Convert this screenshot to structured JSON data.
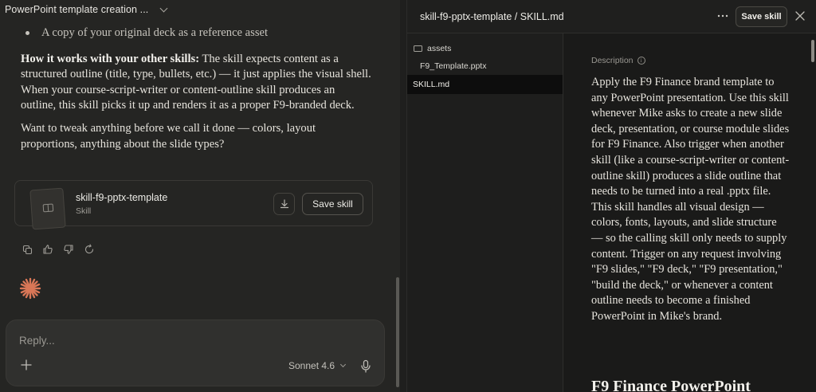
{
  "conversation": {
    "title": "PowerPoint template creation ...",
    "bullet_text": "A copy of your original deck as a reference asset",
    "para1_bold": "How it works with your other skills:",
    "para1_rest": " The skill expects content as a structured outline (title, type, bullets, etc.) — it just applies the visual shell. When your course-script-writer or content-outline skill produces an outline, this skill picks it up and renders it as a proper F9-branded deck.",
    "para2": "Want to tweak anything before we call it done — colors, layout proportions, anything about the slide types?",
    "skill_card": {
      "name": "skill-f9-pptx-template",
      "type": "Skill",
      "save_label": "Save skill"
    },
    "actions": [
      "copy-icon",
      "thumbs-up-icon",
      "thumbs-down-icon",
      "retry-icon"
    ]
  },
  "composer": {
    "placeholder": "Reply...",
    "model": "Sonnet 4.6"
  },
  "panel": {
    "path": "skill-f9-pptx-template / SKILL.md",
    "save_label": "Save skill",
    "tree": {
      "folder": "assets",
      "file_in_folder": "F9_Template.pptx",
      "selected_file": "SKILL.md"
    },
    "description_label": "Description",
    "description_text": "Apply the F9 Finance brand template to any PowerPoint presentation. Use this skill whenever Mike asks to create a new slide deck, presentation, or course module slides for F9 Finance. Also trigger when another skill (like a course-script-writer or content-outline skill) produces a slide outline that needs to be turned into a real .pptx file. This skill handles all visual design — colors, fonts, layouts, and slide structure — so the calling skill only needs to supply content. Trigger on any request involving \"F9 slides,\" \"F9 deck,\" \"F9 presentation,\" \"build the deck,\" or whenever a content outline needs to become a finished PowerPoint in Mike's brand.",
    "heading": "F9 Finance PowerPoint"
  },
  "colors": {
    "accent_spark": "#d97757",
    "left_bg": "#252523",
    "right_bg": "#1a1a19"
  }
}
